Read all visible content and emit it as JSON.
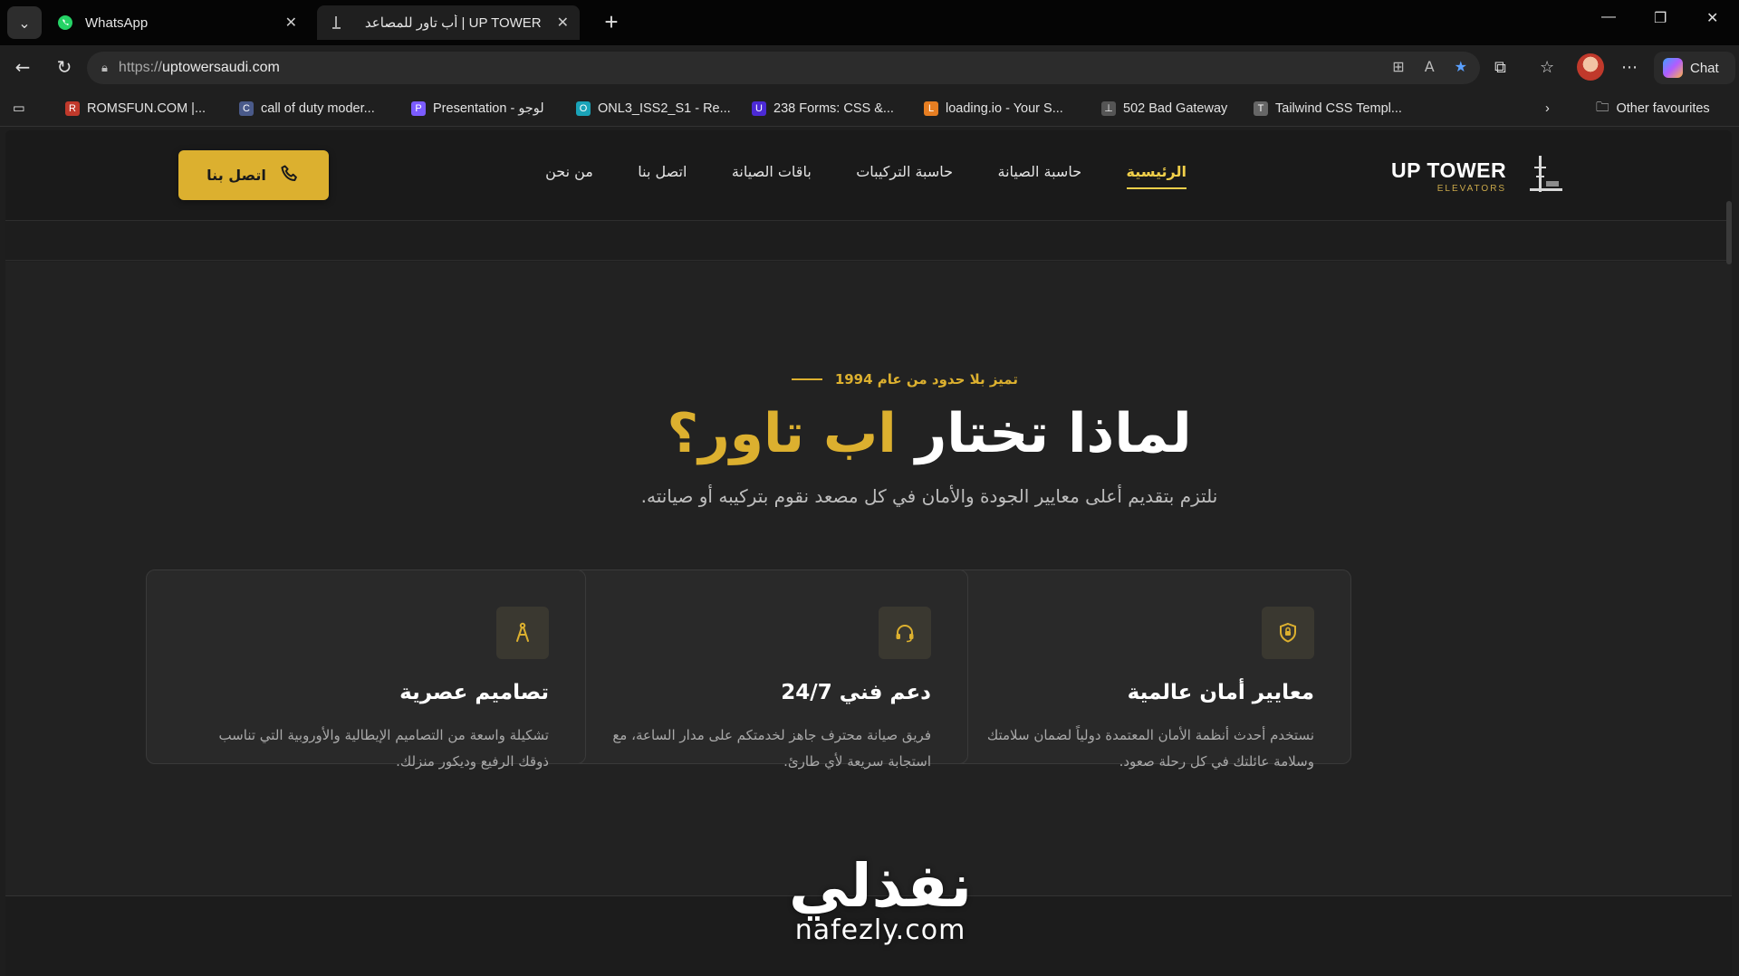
{
  "browser": {
    "tabs": [
      {
        "title": "WhatsApp",
        "icon": "whatsapp-icon"
      },
      {
        "title": "UP TOWER | أب تاور للمصاعد",
        "icon": "up-tower-favicon"
      }
    ],
    "address": {
      "protocol": "https://",
      "host": "uptowersaudi.com"
    },
    "chat_label": "Chat",
    "bookmarks": [
      {
        "label": "ROMSFUN.COM |...",
        "color": "#c0392b"
      },
      {
        "label": "call of duty moder...",
        "color": "#4a5a8a"
      },
      {
        "label": "Presentation - لوجو",
        "color": "#7b5cff"
      },
      {
        "label": "ONL3_ISS2_S1 - Re...",
        "color": "#1aa3b8"
      },
      {
        "label": "238 Forms: CSS &...",
        "color": "#4b2ad6"
      },
      {
        "label": "loading.io - Your S...",
        "color": "#e67e22"
      },
      {
        "label": "502 Bad Gateway",
        "color": "#555555"
      },
      {
        "label": "Tailwind CSS Templ...",
        "color": "#666666"
      }
    ],
    "other_favourites": "Other favourites"
  },
  "site": {
    "logo": {
      "main": "UP TOWER",
      "sub": "ELEVATORS"
    },
    "nav": [
      {
        "label": "الرئيسية",
        "active": true
      },
      {
        "label": "حاسبة الصيانة",
        "active": false
      },
      {
        "label": "حاسبة التركيبات",
        "active": false
      },
      {
        "label": "باقات الصيانة",
        "active": false
      },
      {
        "label": "اتصل بنا",
        "active": false
      },
      {
        "label": "من نحن",
        "active": false
      }
    ],
    "cta_label": "اتصل بنا",
    "accent": "#dcb02f"
  },
  "hero": {
    "eyebrow": "تميز بلا حدود من عام 1994",
    "headline_plain": "لماذا تختار ",
    "headline_highlight": "اب تاور؟",
    "lead": "نلتزم بتقديم أعلى معايير الجودة والأمان في كل مصعد نقوم بتركيبه أو صيانته."
  },
  "features": [
    {
      "title": "معايير أمان عالمية",
      "desc": "نستخدم أحدث أنظمة الأمان المعتمدة دولياً لضمان سلامتك وسلامة عائلتك في كل رحلة صعود.",
      "icon": "shield-lock-icon"
    },
    {
      "title": "دعم فني 24/7",
      "desc": "فريق صيانة محترف جاهز لخدمتكم على مدار الساعة، مع استجابة سريعة لأي طارئ.",
      "icon": "headset-icon"
    },
    {
      "title": "تصاميم عصرية",
      "desc": "تشكيلة واسعة من التصاميم الإيطالية والأوروبية التي تناسب ذوقك الرفيع وديكور منزلك.",
      "icon": "compass-icon"
    }
  ],
  "watermark": {
    "arabic": "نفذلي",
    "latin": "nafezly.com"
  }
}
